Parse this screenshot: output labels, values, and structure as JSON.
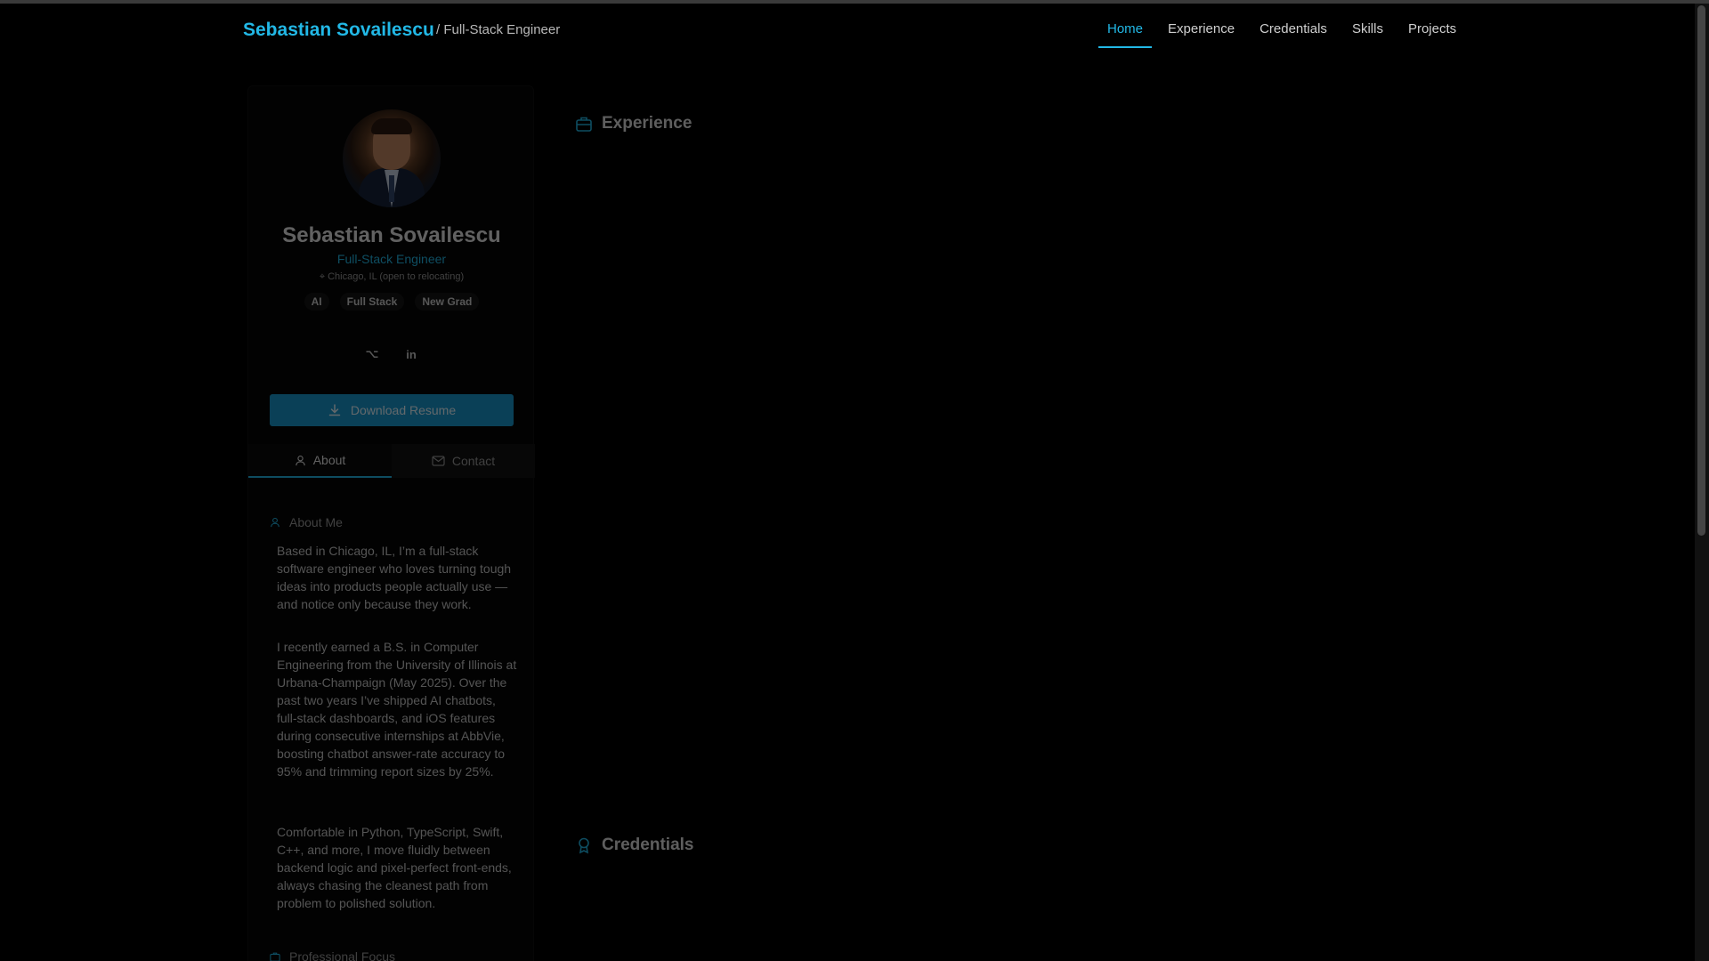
{
  "nav": {
    "brand": "Sebastian Sovailescu",
    "subtitle": "/ Full-Stack Engineer",
    "links": [
      {
        "label": "Home",
        "active": true
      },
      {
        "label": "Experience",
        "active": false
      },
      {
        "label": "Credentials",
        "active": false
      },
      {
        "label": "Skills",
        "active": false
      },
      {
        "label": "Projects",
        "active": false
      }
    ]
  },
  "profile": {
    "name": "Sebastian Sovailescu",
    "role": "Full-Stack Engineer",
    "location": "Chicago, IL (open to relocating)",
    "tags": [
      "AI",
      "Full Stack",
      "New Grad"
    ],
    "socials": [
      {
        "icon": "github-icon",
        "glyph": "⌥"
      },
      {
        "icon": "linkedin-icon",
        "glyph": "in"
      }
    ],
    "download_label": "Download Resume"
  },
  "tabs": [
    {
      "label": "About",
      "icon": "user-icon",
      "active": true
    },
    {
      "label": "Contact",
      "icon": "mail-icon",
      "active": false
    }
  ],
  "about": {
    "heading": "About Me",
    "paragraphs": [
      "Based in Chicago, IL, I’m a full-stack software engineer who loves turning tough ideas into products people actually use — and notice only because they work.",
      "I recently earned a B.S. in Computer Engineering from the University of Illinois at Urbana-Champaign (May 2025). Over the past two years I’ve shipped AI chatbots, full-stack dashboards, and iOS features during consecutive internships at AbbVie, boosting chatbot answer-rate accuracy to 95% and trimming report sizes by 25%.",
      "Comfortable in Python, TypeScript, Swift, C++, and more, I move fluidly between backend logic and pixel-perfect front-ends, always chasing the cleanest path from problem to polished solution."
    ],
    "next_heading": "Professional Focus"
  },
  "main": {
    "experience_heading": "Experience",
    "credentials_heading": "Credentials"
  },
  "colors": {
    "accent": "#22b8e6",
    "background": "#000000"
  }
}
